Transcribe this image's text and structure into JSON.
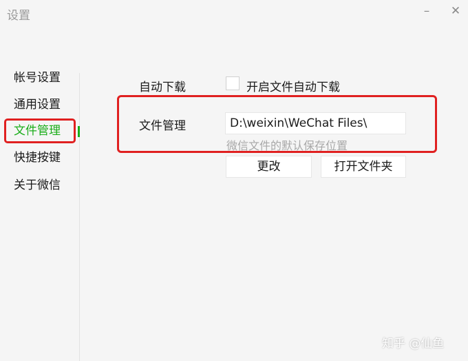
{
  "window": {
    "title": "设置",
    "minimize_glyph": "–",
    "close_glyph": "✕"
  },
  "sidebar": {
    "items": [
      {
        "label": "帐号设置"
      },
      {
        "label": "通用设置"
      },
      {
        "label": "文件管理",
        "active": true
      },
      {
        "label": "快捷按键"
      },
      {
        "label": "关于微信"
      }
    ]
  },
  "auto_download": {
    "label": "自动下载",
    "checkbox_label": "开启文件自动下载",
    "checked": false
  },
  "file_management": {
    "label": "文件管理",
    "path_value": "D:\\weixin\\WeChat Files\\",
    "hint": "微信文件的默认保存位置",
    "change_button": "更改",
    "open_folder_button": "打开文件夹"
  },
  "watermark": "知乎 @仙鱼",
  "colors": {
    "accent_green": "#1aad19",
    "highlight_red": "#e02020",
    "background": "#f5f5f5",
    "hint_gray": "#a8a8a8"
  }
}
